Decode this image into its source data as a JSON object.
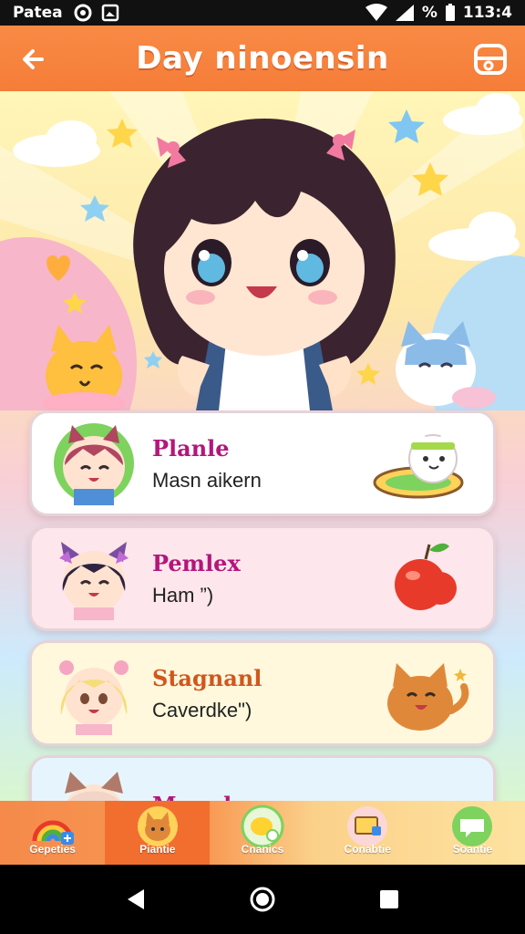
{
  "status_bar": {
    "carrier": "Patea",
    "battery_label": "%",
    "time": "113:4"
  },
  "app_bar": {
    "title": "Day ninoensin",
    "back_icon": "arrow-left-icon",
    "action_icon": "chat-box-icon"
  },
  "cards": [
    {
      "name": "Planle",
      "subtitle": "Masn aikern",
      "name_color": "#b3167a",
      "background": "#ffffff",
      "decoration": "cat-on-skateboard"
    },
    {
      "name": "Pemlex",
      "subtitle": "Ham ”)",
      "name_color": "#b3167a",
      "background": "#fde6ec",
      "decoration": "red-apple"
    },
    {
      "name": "Stagnanl",
      "subtitle": "Caverdke\")",
      "name_color": "#d2561d",
      "background": "#fff8dc",
      "decoration": "orange-cat"
    },
    {
      "name": "Mraada",
      "subtitle": "",
      "name_color": "#b3167a",
      "background": "#e6f5fd",
      "decoration": "cat"
    }
  ],
  "bottom_nav": [
    {
      "label": "Gepeties",
      "icon": "rainbow-icon",
      "active": false
    },
    {
      "label": "Piantie",
      "icon": "cat-face-icon",
      "active": true
    },
    {
      "label": "Cnanics",
      "icon": "lemon-icon",
      "active": false
    },
    {
      "label": "Conabtie",
      "icon": "gift-icon",
      "active": false
    },
    {
      "label": "Soantie",
      "icon": "chat-bubble-icon",
      "active": false
    }
  ],
  "system_nav": {
    "back": "back-triangle-icon",
    "home": "home-circle-icon",
    "recents": "recents-square-icon"
  }
}
